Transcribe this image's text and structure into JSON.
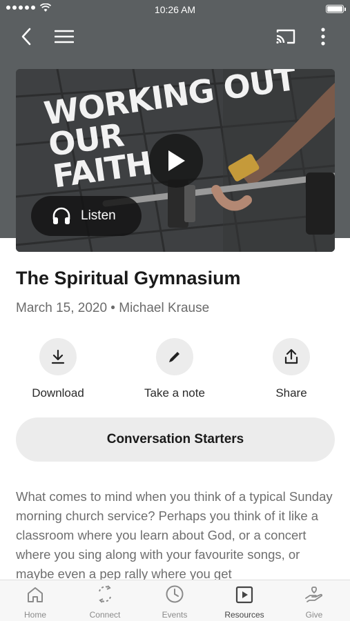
{
  "status_bar": {
    "time": "10:26 AM"
  },
  "nav": {
    "back_icon": "chevron-left-icon",
    "menu_icon": "hamburger-icon",
    "cast_icon": "cast-icon",
    "more_icon": "vertical-dots-icon"
  },
  "hero": {
    "title_lines": [
      "WORKING OUT",
      "OUR",
      "FAITH"
    ],
    "listen_label": "Listen"
  },
  "sermon": {
    "title": "The Spiritual Gymnasium",
    "meta": "March 15, 2020 • Michael Krause"
  },
  "actions": [
    {
      "label": "Download",
      "icon": "download-icon"
    },
    {
      "label": "Take a note",
      "icon": "pencil-icon"
    },
    {
      "label": "Share",
      "icon": "share-icon"
    }
  ],
  "conversation_button": "Conversation Starters",
  "description": "What comes to mind when you think of a typical Sunday morning church service? Perhaps you think of it like a classroom where you learn about God, or a concert where you sing along with your favourite songs, or maybe even a pep rally where you get",
  "tabs": [
    {
      "label": "Home",
      "icon": "home-icon",
      "active": false
    },
    {
      "label": "Connect",
      "icon": "connect-icon",
      "active": false
    },
    {
      "label": "Events",
      "icon": "clock-icon",
      "active": false
    },
    {
      "label": "Resources",
      "icon": "play-square-icon",
      "active": true
    },
    {
      "label": "Give",
      "icon": "give-hand-icon",
      "active": false
    }
  ],
  "colors": {
    "header_bg": "#5b5f61",
    "chip_bg": "#ececec",
    "text_muted": "#6e6e6e"
  }
}
